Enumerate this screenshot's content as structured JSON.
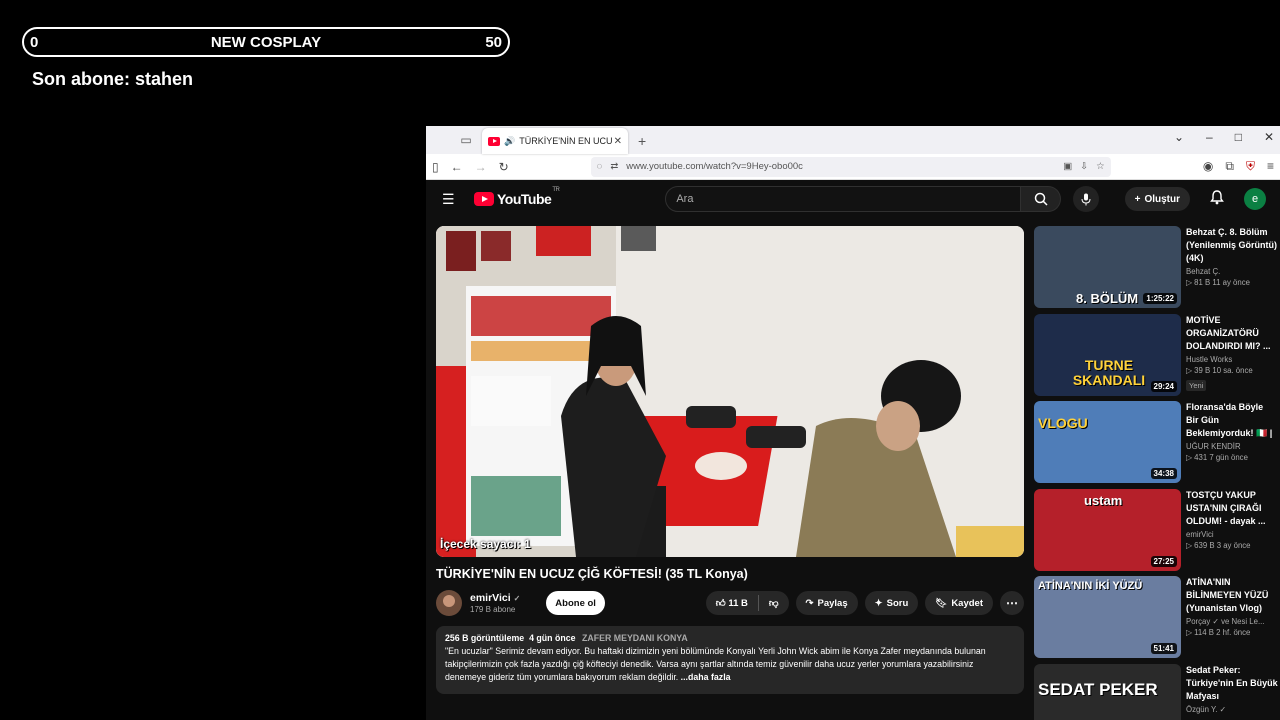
{
  "overlay": {
    "goal_current": "0",
    "goal_title": "NEW COSPLAY",
    "goal_target": "50",
    "last_sub": "Son abone: stahen"
  },
  "browser": {
    "tab_title": "TÜRKİYE'NİN EN UCUZ ÇİĞ",
    "url": "www.youtube.com/watch?v=9Hey-obo00c"
  },
  "youtube": {
    "logo": "YouTube",
    "logo_region": "TR",
    "search_placeholder": "Ara",
    "create_label": "Oluştur",
    "avatar_letter": "e"
  },
  "video": {
    "overlay_text": "İçecek sayacı: 1",
    "title": "TÜRKİYE'NİN EN UCUZ ÇİĞ KÖFTESİ! (35 TL Konya)",
    "channel": "emirVici",
    "subscribers": "179 B abone",
    "subscribe_label": "Abone ol",
    "likes": "11 B",
    "share_label": "Paylaş",
    "ask_label": "Soru",
    "save_label": "Kaydet",
    "views": "256 B görüntüleme",
    "date": "4 gün önce",
    "location_tag": "ZAFER MEYDANI KONYA",
    "description": "\"En ucuzlar\" Serimiz devam ediyor. Bu haftaki dizimizin yeni bölümünde Konyalı Yerli John Wick abim ile Konya Zafer meydanında bulunan takipçilerimizin çok fazla yazdığı çiğ köfteciyi denedik. Varsa aynı şartlar altında temiz güvenilir daha ucuz yerler yorumlara yazabilirsiniz denemeye gideriz tüm yorumlara bakıyorum reklam değildir.",
    "more_label": "...daha fazla"
  },
  "recommendations": [
    {
      "title": "Behzat Ç. 8. Bölüm (Yenilenmiş Görüntü) (4K)",
      "channel": "Behzat Ç.",
      "stats": "▷ 81 B   11 ay önce",
      "duration": "1:25:22",
      "thumb_text": "8. BÖLÜM",
      "color": "#3a4a5e"
    },
    {
      "title": "MOTİVE ORGANİZATÖRÜ DOLANDIRDI MI? ...",
      "channel": "Hustle Works",
      "stats": "▷ 39 B   10 sa. önce",
      "duration": "29:24",
      "thumb_text": "TURNE SKANDALI",
      "badge": "Yeni",
      "color": "#1e2c4a"
    },
    {
      "title": "Floransa'da Böyle Bir Gün Beklemiyorduk! 🇮🇹 |",
      "channel": "UĞUR KENDİR",
      "stats": "▷ 431   7 gün önce",
      "duration": "34:38",
      "thumb_text": "VLOGU",
      "color": "#4f7db8"
    },
    {
      "title": "TOSTÇU YAKUP USTA'NIN ÇIRAĞI OLDUM! - dayak ...",
      "channel": "emirVici",
      "stats": "▷ 639 B   3 ay önce",
      "duration": "27:25",
      "thumb_text": "ustam",
      "color": "#b5202a"
    },
    {
      "title": "ATİNA'NIN BİLİNMEYEN YÜZÜ (Yunanistan Vlog)",
      "channel": "Porçay ✓ ve Nesi Le...",
      "stats": "▷ 114 B   2 hf. önce",
      "duration": "51:41",
      "thumb_text": "ATİNA'NIN İKİ YÜZÜ",
      "color": "#6a7da0"
    },
    {
      "title": "Sedat Peker: Türkiye'nin En Büyük Mafyası",
      "channel": "Özgün Y. ✓",
      "stats": "",
      "duration": "",
      "thumb_text": "SEDAT PEKER",
      "color": "#2a2a2a"
    }
  ]
}
